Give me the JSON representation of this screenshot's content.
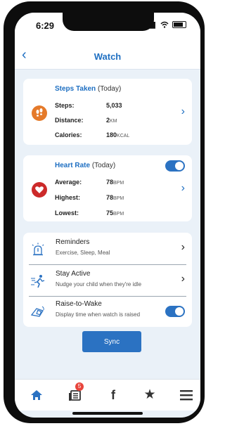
{
  "status": {
    "time": "6:29"
  },
  "header": {
    "title": "Watch"
  },
  "steps": {
    "title": "Steps Taken",
    "subtitle": "(Today)",
    "rows": [
      {
        "label": "Steps:",
        "value": "5,033",
        "unit": ""
      },
      {
        "label": "Distance:",
        "value": "2",
        "unit": "KM"
      },
      {
        "label": "Calories:",
        "value": "180",
        "unit": "KCAL"
      }
    ]
  },
  "heart": {
    "title": "Heart Rate",
    "subtitle": "(Today)",
    "toggle_on": true,
    "rows": [
      {
        "label": "Average:",
        "value": "78",
        "unit": "BPM"
      },
      {
        "label": "Highest:",
        "value": "78",
        "unit": "BPM"
      },
      {
        "label": "Lowest:",
        "value": "75",
        "unit": "BPM"
      }
    ]
  },
  "options": [
    {
      "title": "Reminders",
      "desc": "Exercise, Sleep, Meal",
      "control": "chevron"
    },
    {
      "title": "Stay Active",
      "desc": "Nudge your child when they're idle",
      "control": "chevron"
    },
    {
      "title": "Raise-to-Wake",
      "desc": "Display time when watch is raised",
      "control": "toggle",
      "toggle_on": true
    }
  ],
  "sync_label": "Sync",
  "tabbar": {
    "notification_count": "5"
  },
  "colors": {
    "accent": "#2b72c2",
    "orange": "#e57a2a",
    "red": "#cc2a2a"
  }
}
